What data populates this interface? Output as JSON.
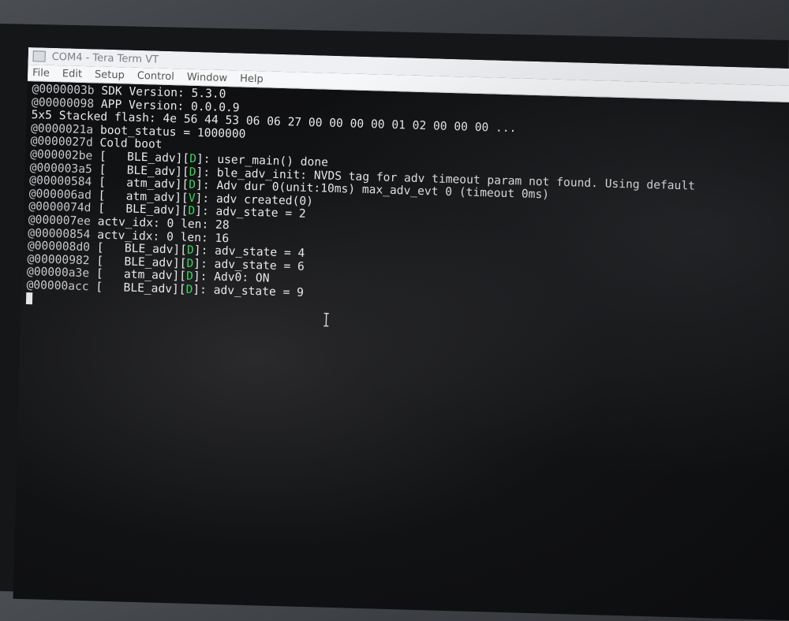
{
  "window": {
    "title": "COM4 - Tera Term VT"
  },
  "menu": {
    "file": "File",
    "edit": "Edit",
    "setup": "Setup",
    "control": "Control",
    "window": "Window",
    "help": "Help"
  },
  "terminal": {
    "lines": [
      {
        "addr": "@0000003b",
        "text": " SDK Version: 5.3.0"
      },
      {
        "addr": "@00000098",
        "text": " APP Version: 0.0.0.9"
      },
      {
        "addr": "",
        "text": "5x5 Stacked flash: 4e 56 44 53 06 06 27 00 00 00 00 01 02 00 00 00 ..."
      },
      {
        "addr": "@0000021a",
        "text": " boot_status = 1000000"
      },
      {
        "addr": "@0000027d",
        "text": " Cold boot"
      },
      {
        "addr": "@000002be",
        "pre": " [   BLE_adv][",
        "tag": "D",
        "text": "]: user_main() done"
      },
      {
        "addr": "@000003a5",
        "pre": " [   BLE_adv][",
        "tag": "D",
        "text": "]: ble_adv_init: NVDS tag for adv timeout param not found. Using default"
      },
      {
        "addr": "@00000584",
        "pre": " [   atm_adv][",
        "tag": "D",
        "text": "]: Adv dur 0(unit:10ms) max_adv_evt 0 (timeout 0ms)"
      },
      {
        "addr": "@000006ad",
        "pre": " [   atm_adv][",
        "tag": "V",
        "text": "]: adv created(0)"
      },
      {
        "addr": "@0000074d",
        "pre": " [   BLE_adv][",
        "tag": "D",
        "text": "]: adv_state = 2"
      },
      {
        "addr": "@000007ee",
        "text": " actv_idx: 0 len: 28"
      },
      {
        "addr": "@00000854",
        "text": " actv_idx: 0 len: 16"
      },
      {
        "addr": "@000008d0",
        "pre": " [   BLE_adv][",
        "tag": "D",
        "text": "]: adv_state = 4"
      },
      {
        "addr": "@00000982",
        "pre": " [   BLE_adv][",
        "tag": "D",
        "text": "]: adv_state = 6"
      },
      {
        "addr": "@00000a3e",
        "pre": " [   atm_adv][",
        "tag": "D",
        "text": "]: Adv0: ON"
      },
      {
        "addr": "@00000acc",
        "pre": " [   BLE_adv][",
        "tag": "D",
        "text": "]: adv_state = 9"
      }
    ]
  },
  "colors": {
    "terminal_bg": "#0b0c0e",
    "terminal_fg": "#e9e9ea",
    "tag_color": "#3fd35a"
  }
}
